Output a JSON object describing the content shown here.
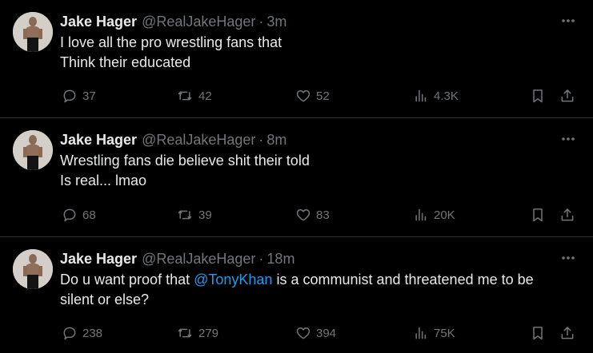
{
  "tweets": [
    {
      "author_name": "Jake Hager",
      "author_handle": "@RealJakeHager",
      "separator": "·",
      "time": "3m",
      "text_lines": [
        [
          {
            "text": "I love all the pro wrestling fans that"
          }
        ],
        [
          {
            "text": "Think their educated"
          }
        ]
      ],
      "replies": "37",
      "reposts": "42",
      "likes": "52",
      "views": "4.3K"
    },
    {
      "author_name": "Jake Hager",
      "author_handle": "@RealJakeHager",
      "separator": "·",
      "time": "8m",
      "text_lines": [
        [
          {
            "text": "Wrestling fans die believe shit their told"
          }
        ],
        [
          {
            "text": "Is real... lmao"
          }
        ]
      ],
      "replies": "68",
      "reposts": "39",
      "likes": "83",
      "views": "20K"
    },
    {
      "author_name": "Jake Hager",
      "author_handle": "@RealJakeHager",
      "separator": "·",
      "time": "18m",
      "text_lines": [
        [
          {
            "text": "Do u want proof that "
          },
          {
            "text": "@TonyKhan",
            "mention": true
          },
          {
            "text": " is a communist and threatened me to be"
          }
        ],
        [
          {
            "text": "silent or else?"
          }
        ]
      ],
      "replies": "238",
      "reposts": "279",
      "likes": "394",
      "views": "75K"
    }
  ],
  "icons": {
    "avatar": "profile-photo",
    "more": "more-horizontal-icon",
    "reply": "reply-icon",
    "repost": "repost-icon",
    "like": "heart-icon",
    "views": "views-chart-icon",
    "bookmark": "bookmark-icon",
    "share": "share-icon"
  },
  "colors": {
    "background": "#000000",
    "text": "#e7e9ea",
    "muted": "#71767b",
    "divider": "#2f3336",
    "mention": "#1d9bf0"
  }
}
